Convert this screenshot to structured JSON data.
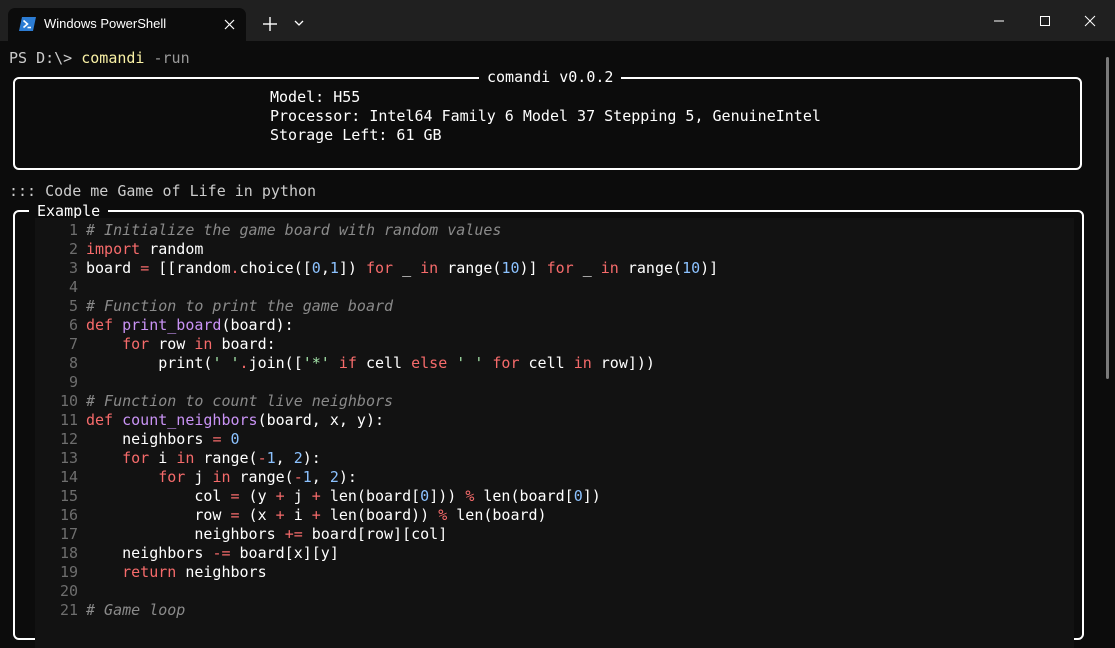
{
  "window": {
    "tab_title": "Windows PowerShell",
    "icons": [
      "powershell-icon",
      "close-icon",
      "plus-icon",
      "chevron-down-icon",
      "minimize-icon",
      "maximize-icon",
      "close-icon"
    ]
  },
  "prompt": {
    "ps": "PS D:\\> ",
    "command": "comandi",
    "flag": " -run"
  },
  "info_box": {
    "title": "comandi v0.0.2",
    "lines": [
      "Model: H55",
      "Processor: Intel64 Family 6 Model 37 Stepping 5, GenuineIntel",
      "Storage Left: 61 GB"
    ]
  },
  "query": "::: Code me Game of Life in python",
  "example_box": {
    "title": "Example",
    "code_lines": [
      {
        "n": "1",
        "tokens": [
          [
            "c",
            "# Initialize the game board with random values"
          ]
        ]
      },
      {
        "n": "2",
        "tokens": [
          [
            "k",
            "import"
          ],
          [
            "p",
            " random"
          ]
        ]
      },
      {
        "n": "3",
        "tokens": [
          [
            "p",
            "board "
          ],
          [
            "o",
            "="
          ],
          [
            "p",
            " [[random"
          ],
          [
            "o",
            "."
          ],
          [
            "p",
            "choice(["
          ],
          [
            "n",
            "0"
          ],
          [
            "p",
            ","
          ],
          [
            "n",
            "1"
          ],
          [
            "p",
            "]) "
          ],
          [
            "k",
            "for"
          ],
          [
            "p",
            " _ "
          ],
          [
            "k",
            "in"
          ],
          [
            "p",
            " range("
          ],
          [
            "n",
            "10"
          ],
          [
            "p",
            ")] "
          ],
          [
            "k",
            "for"
          ],
          [
            "p",
            " _ "
          ],
          [
            "k",
            "in"
          ],
          [
            "p",
            " range("
          ],
          [
            "n",
            "10"
          ],
          [
            "p",
            ")]"
          ]
        ]
      },
      {
        "n": "4",
        "tokens": []
      },
      {
        "n": "5",
        "tokens": [
          [
            "c",
            "# Function to print the game board"
          ]
        ]
      },
      {
        "n": "6",
        "tokens": [
          [
            "k",
            "def"
          ],
          [
            "p",
            " "
          ],
          [
            "f",
            "print_board"
          ],
          [
            "p",
            "(board):"
          ]
        ]
      },
      {
        "n": "7",
        "tokens": [
          [
            "p",
            "    "
          ],
          [
            "k",
            "for"
          ],
          [
            "p",
            " row "
          ],
          [
            "k",
            "in"
          ],
          [
            "p",
            " board:"
          ]
        ]
      },
      {
        "n": "8",
        "tokens": [
          [
            "p",
            "        print("
          ],
          [
            "s",
            "' '"
          ],
          [
            "o",
            "."
          ],
          [
            "p",
            "join(["
          ],
          [
            "s",
            "'*'"
          ],
          [
            "p",
            " "
          ],
          [
            "k",
            "if"
          ],
          [
            "p",
            " cell "
          ],
          [
            "k",
            "else"
          ],
          [
            "p",
            " "
          ],
          [
            "s",
            "' '"
          ],
          [
            "p",
            " "
          ],
          [
            "k",
            "for"
          ],
          [
            "p",
            " cell "
          ],
          [
            "k",
            "in"
          ],
          [
            "p",
            " row]))"
          ]
        ]
      },
      {
        "n": "9",
        "tokens": []
      },
      {
        "n": "10",
        "tokens": [
          [
            "c",
            "# Function to count live neighbors"
          ]
        ]
      },
      {
        "n": "11",
        "tokens": [
          [
            "k",
            "def"
          ],
          [
            "p",
            " "
          ],
          [
            "f",
            "count_neighbors"
          ],
          [
            "p",
            "(board, x, y):"
          ]
        ]
      },
      {
        "n": "12",
        "tokens": [
          [
            "p",
            "    neighbors "
          ],
          [
            "o",
            "="
          ],
          [
            "p",
            " "
          ],
          [
            "n",
            "0"
          ]
        ]
      },
      {
        "n": "13",
        "tokens": [
          [
            "p",
            "    "
          ],
          [
            "k",
            "for"
          ],
          [
            "p",
            " i "
          ],
          [
            "k",
            "in"
          ],
          [
            "p",
            " range("
          ],
          [
            "o",
            "-"
          ],
          [
            "n",
            "1"
          ],
          [
            "p",
            ", "
          ],
          [
            "n",
            "2"
          ],
          [
            "p",
            "):"
          ]
        ]
      },
      {
        "n": "14",
        "tokens": [
          [
            "p",
            "        "
          ],
          [
            "k",
            "for"
          ],
          [
            "p",
            " j "
          ],
          [
            "k",
            "in"
          ],
          [
            "p",
            " range("
          ],
          [
            "o",
            "-"
          ],
          [
            "n",
            "1"
          ],
          [
            "p",
            ", "
          ],
          [
            "n",
            "2"
          ],
          [
            "p",
            "):"
          ]
        ]
      },
      {
        "n": "15",
        "tokens": [
          [
            "p",
            "            col "
          ],
          [
            "o",
            "="
          ],
          [
            "p",
            " (y "
          ],
          [
            "o",
            "+"
          ],
          [
            "p",
            " j "
          ],
          [
            "o",
            "+"
          ],
          [
            "p",
            " len(board["
          ],
          [
            "n",
            "0"
          ],
          [
            "p",
            "])) "
          ],
          [
            "o",
            "%"
          ],
          [
            "p",
            " len(board["
          ],
          [
            "n",
            "0"
          ],
          [
            "p",
            "])"
          ]
        ]
      },
      {
        "n": "16",
        "tokens": [
          [
            "p",
            "            row "
          ],
          [
            "o",
            "="
          ],
          [
            "p",
            " (x "
          ],
          [
            "o",
            "+"
          ],
          [
            "p",
            " i "
          ],
          [
            "o",
            "+"
          ],
          [
            "p",
            " len(board)) "
          ],
          [
            "o",
            "%"
          ],
          [
            "p",
            " len(board)"
          ]
        ]
      },
      {
        "n": "17",
        "tokens": [
          [
            "p",
            "            neighbors "
          ],
          [
            "o",
            "+="
          ],
          [
            "p",
            " board[row][col]"
          ]
        ]
      },
      {
        "n": "18",
        "tokens": [
          [
            "p",
            "    neighbors "
          ],
          [
            "o",
            "-="
          ],
          [
            "p",
            " board[x][y]"
          ]
        ]
      },
      {
        "n": "19",
        "tokens": [
          [
            "p",
            "    "
          ],
          [
            "k",
            "return"
          ],
          [
            "p",
            " neighbors"
          ]
        ]
      },
      {
        "n": "20",
        "tokens": []
      },
      {
        "n": "21",
        "tokens": [
          [
            "c",
            "# Game loop"
          ]
        ]
      }
    ]
  }
}
